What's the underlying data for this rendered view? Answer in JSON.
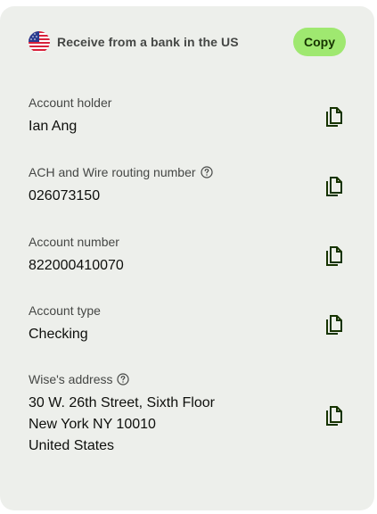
{
  "header": {
    "title": "Receive from a bank in the US",
    "copy_label": "Copy"
  },
  "fields": [
    {
      "label": "Account holder",
      "value_lines": [
        "Ian Ang"
      ],
      "has_info": false
    },
    {
      "label": "ACH and Wire routing number",
      "value_lines": [
        "026073150"
      ],
      "has_info": true
    },
    {
      "label": "Account number",
      "value_lines": [
        "822000410070"
      ],
      "has_info": false
    },
    {
      "label": "Account type",
      "value_lines": [
        "Checking"
      ],
      "has_info": false
    },
    {
      "label": "Wise's address",
      "value_lines": [
        "30 W. 26th Street, Sixth Floor",
        "New York NY 10010",
        "United States"
      ],
      "has_info": true
    }
  ],
  "colors": {
    "card_background": "#edefeb",
    "copy_button": "#9fe870",
    "copy_icon": "#163300"
  },
  "icons": {
    "flag": "us-flag-icon",
    "info": "info-icon",
    "copy": "copy-icon"
  }
}
